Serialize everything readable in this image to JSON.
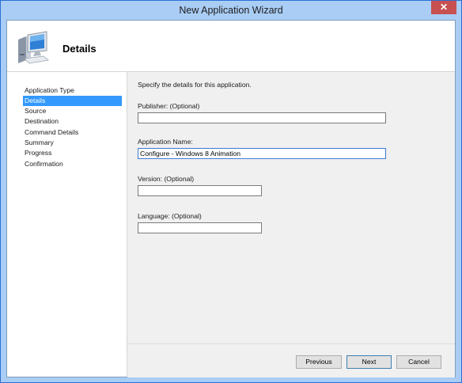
{
  "window": {
    "title": "New Application Wizard",
    "close_label": "✕"
  },
  "header": {
    "title": "Details",
    "icon": "computer-icon"
  },
  "nav": {
    "items": [
      {
        "label": "Application Type",
        "selected": false
      },
      {
        "label": "Details",
        "selected": true
      },
      {
        "label": "Source",
        "selected": false
      },
      {
        "label": "Destination",
        "selected": false
      },
      {
        "label": "Command Details",
        "selected": false
      },
      {
        "label": "Summary",
        "selected": false
      },
      {
        "label": "Progress",
        "selected": false
      },
      {
        "label": "Confirmation",
        "selected": false
      }
    ]
  },
  "main": {
    "intro": "Specify the details for this application.",
    "publisher": {
      "label": "Publisher: (Optional)",
      "value": ""
    },
    "app_name": {
      "label": "Application Name:",
      "value": "Configure - Windows 8 Animation"
    },
    "version": {
      "label": "Version: (Optional)",
      "value": ""
    },
    "language": {
      "label": "Language: (Optional)",
      "value": ""
    }
  },
  "footer": {
    "previous": "Previous",
    "next": "Next",
    "cancel": "Cancel"
  },
  "colors": {
    "selection": "#3399ff",
    "titlebar": "#a9cdf5",
    "close": "#c75050"
  }
}
